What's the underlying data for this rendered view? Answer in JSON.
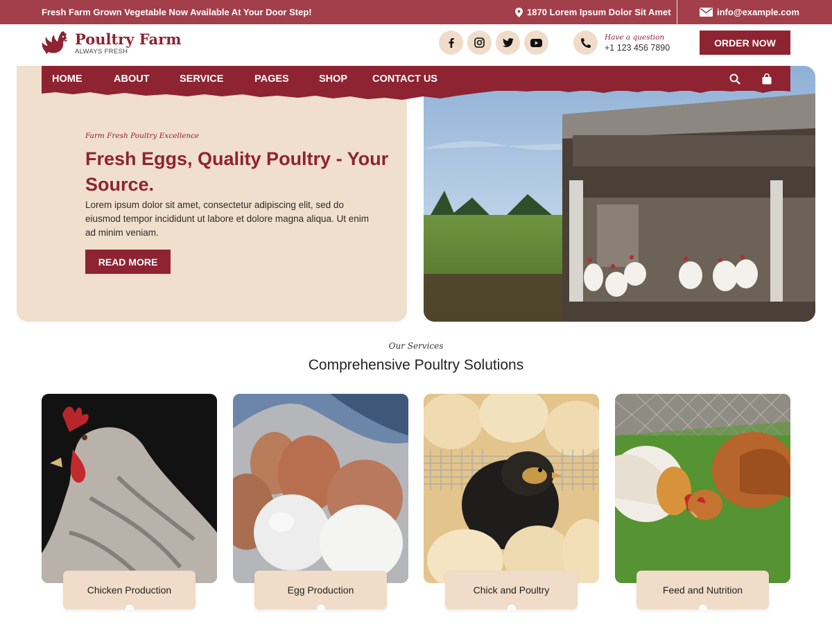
{
  "topbar": {
    "promo": "Fresh Farm Grown Vegetable Now Available At Your Door Step!",
    "address": "1870 Lorem Ipsum Dolor Sit Amet",
    "email": "info@example.com"
  },
  "header": {
    "logo_name": "Poultry Farm",
    "logo_tagline": "ALWAYS FRESH",
    "question_label": "Have a question",
    "phone": "+1 123 456 7890",
    "order_label": "ORDER NOW"
  },
  "nav": {
    "items": [
      "HOME",
      "ABOUT",
      "SERVICE",
      "PAGES",
      "SHOP",
      "CONTACT US"
    ]
  },
  "hero": {
    "subtitle": "Farm Fresh Poultry Excellence",
    "title": "Fresh Eggs, Quality Poultry - Your Source.",
    "text": "Lorem ipsum dolor sit amet, consectetur adipiscing elit, sed do eiusmod tempor incididunt ut labore et dolore magna aliqua. Ut enim ad minim veniam.",
    "button": "READ MORE"
  },
  "services": {
    "subtitle": "Our Services",
    "title": "Comprehensive Poultry Solutions",
    "cards": [
      {
        "label": "Chicken Production"
      },
      {
        "label": "Egg Production"
      },
      {
        "label": "Chick and Poultry"
      },
      {
        "label": "Feed and Nutrition"
      }
    ]
  },
  "colors": {
    "primary": "#8e2331",
    "topbar": "#a23f4a",
    "cream": "#f0dfcc"
  },
  "icons": [
    "location-icon",
    "mail-icon",
    "facebook-icon",
    "instagram-icon",
    "twitter-icon",
    "youtube-icon",
    "phone-icon",
    "search-icon",
    "cart-icon"
  ]
}
